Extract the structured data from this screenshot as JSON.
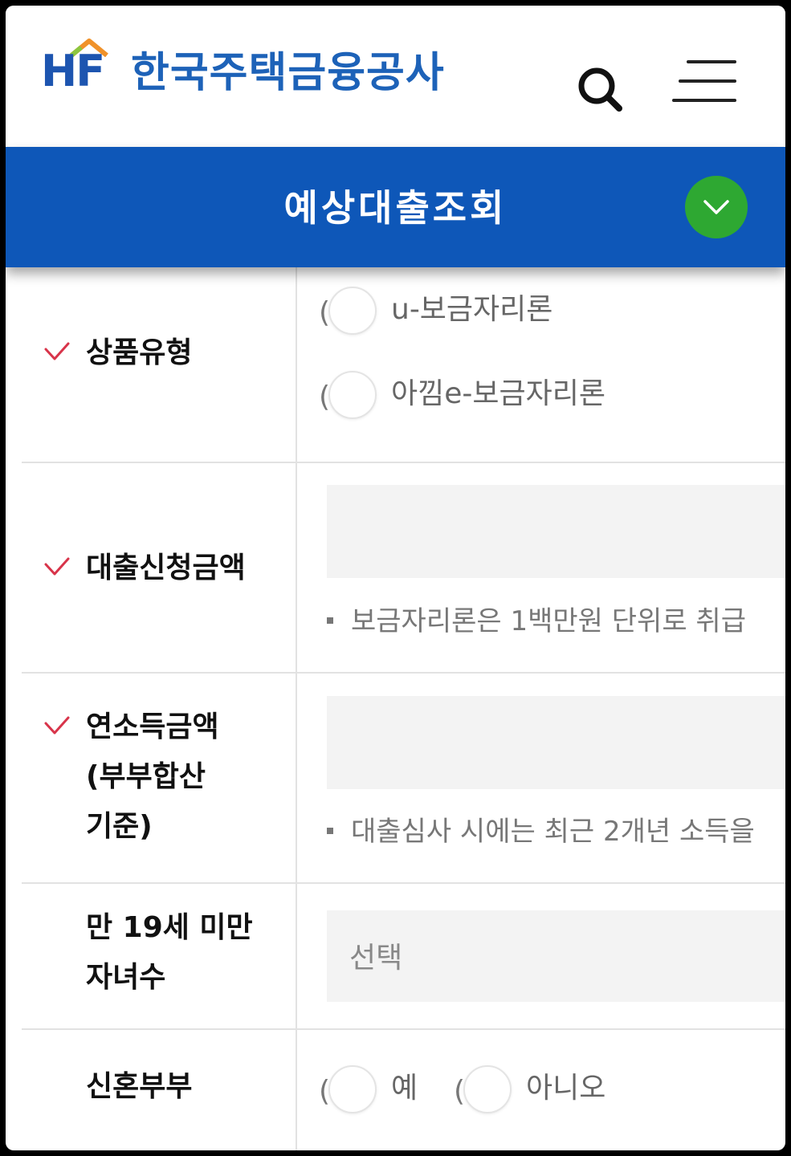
{
  "header": {
    "logo_mark": "HF",
    "logo_name": "한국주택금융공사",
    "search_icon": "search-icon",
    "menu_icon": "hamburger-menu-icon"
  },
  "titlebar": {
    "title": "예상대출조회",
    "toggle_icon": "chevron-down-icon"
  },
  "form": {
    "product_type": {
      "label": "상품유형",
      "required": true,
      "options": [
        {
          "paren": "(",
          "label": "u-보금자리론"
        },
        {
          "paren": "(",
          "label": "아낌e-보금자리론"
        }
      ]
    },
    "loan_amount": {
      "label": "대출신청금액",
      "required": true,
      "value": "",
      "note": "보금자리론은 1백만원 단위로 취급"
    },
    "annual_income": {
      "label_lines": [
        "연소득금액",
        "(부부합산",
        "기준)"
      ],
      "required": true,
      "value": "",
      "note": "대출심사 시에는 최근 2개년 소득을"
    },
    "children": {
      "label_lines": [
        "만 19세 미만",
        "자녀수"
      ],
      "required": false,
      "placeholder": "선택"
    },
    "newlywed": {
      "label": "신혼부부",
      "required": false,
      "options": [
        {
          "paren": "(",
          "label": "예"
        },
        {
          "paren": "(",
          "label": "아니오"
        }
      ]
    }
  },
  "colors": {
    "brand_blue": "#0e57b8",
    "toggle_green": "#2ea832",
    "required_check": "#d8344a"
  }
}
